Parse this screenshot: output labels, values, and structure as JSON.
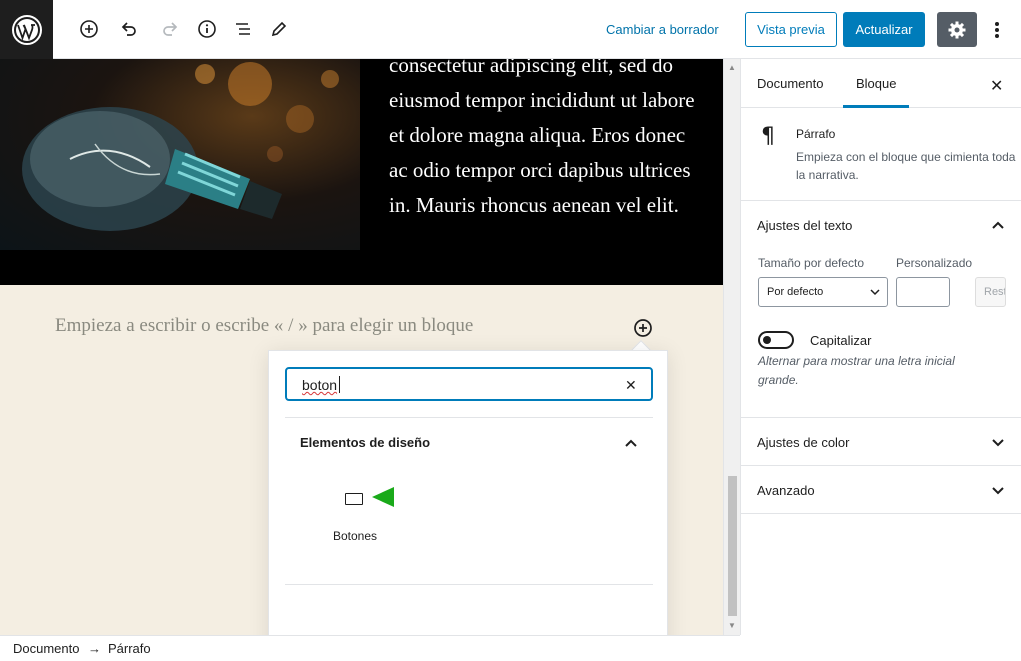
{
  "toolbar": {
    "draft_link": "Cambiar a borrador",
    "preview_label": "Vista previa",
    "update_label": "Actualizar"
  },
  "canvas": {
    "cover_text": "consectetur adipiscing elit, sed do eiusmod tempor incididunt ut labore et dolore magna aliqua. Eros donec ac odio tempor orci dapibus ultrices in. Mauris rhoncus aenean vel elit.",
    "placeholder": "Empieza a escribir o escribe « / » para elegir un bloque"
  },
  "inserter": {
    "search_value": "boton",
    "category_title": "Elementos de diseño",
    "block_label": "Botones"
  },
  "sidebar": {
    "tabs": [
      "Documento",
      "Bloque"
    ],
    "active_tab": "Bloque",
    "block_title": "Párrafo",
    "block_description": "Empieza con el bloque que cimienta toda la narrativa.",
    "text_settings_title": "Ajustes del texto",
    "default_size_label": "Tamaño por defecto",
    "custom_label": "Personalizado",
    "default_size_value": "Por defecto",
    "reset_label": "Restablecer",
    "dropcap_label": "Capitalizar",
    "dropcap_help": "Alternar para mostrar una letra inicial grande.",
    "color_settings_title": "Ajustes de color",
    "advanced_title": "Avanzado"
  },
  "footer": {
    "breadcrumb_root": "Documento",
    "breadcrumb_arrow": "→",
    "breadcrumb_current": "Párrafo"
  },
  "colors": {
    "accent": "#007cba",
    "canvas_bg": "#f4eee2",
    "toolbar_dark": "#1e1e1e",
    "pointer_green": "#1aaa1a"
  }
}
